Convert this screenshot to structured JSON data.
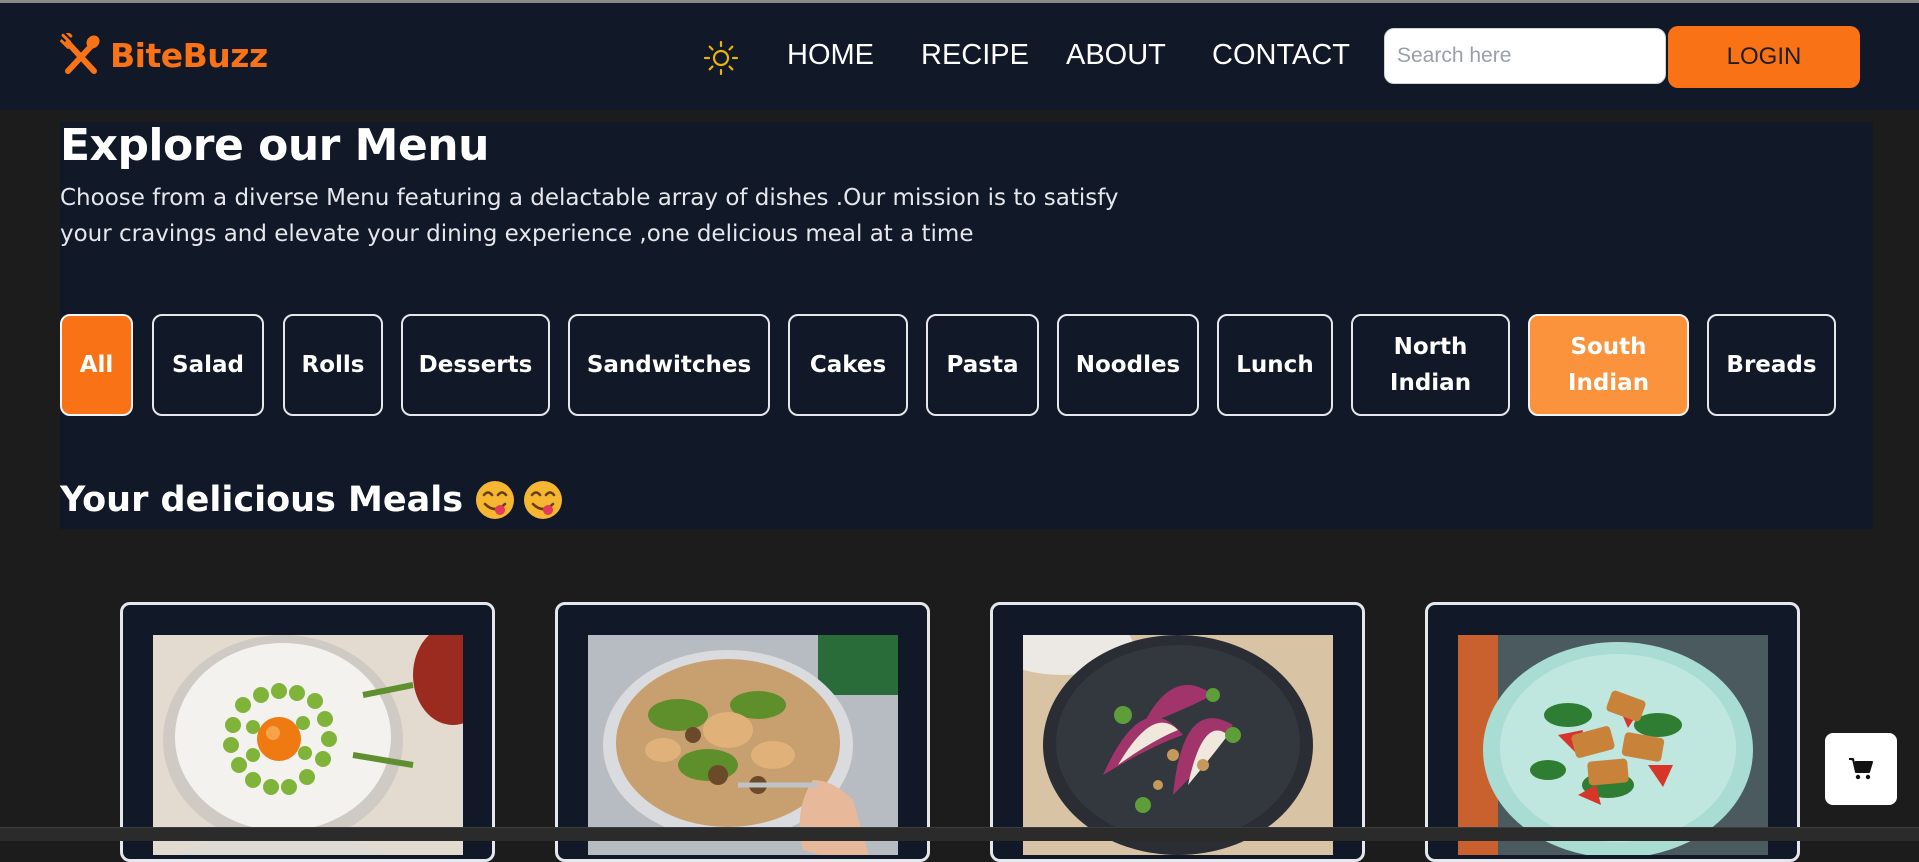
{
  "brand": {
    "name": "BiteBuzz",
    "accent": "#f97316",
    "logo_icon": "fork-knife-icon"
  },
  "nav": {
    "theme_icon": "sun-icon",
    "links": [
      "HOME",
      "RECIPE",
      "ABOUT",
      "CONTACT"
    ],
    "search_placeholder": "Search here",
    "login_label": "LOGIN"
  },
  "menu": {
    "title": "Explore our Menu",
    "description": " Choose from a diverse Menu featuring a delactable array of dishes .Our mission is to satisfy your cravings and elevate your dining experience ,one delicious meal at a time",
    "categories": [
      {
        "label": "All",
        "state": "active"
      },
      {
        "label": "Salad"
      },
      {
        "label": "Rolls"
      },
      {
        "label": "Desserts"
      },
      {
        "label": "Sandwitches"
      },
      {
        "label": "Cakes"
      },
      {
        "label": "Pasta"
      },
      {
        "label": "Noodles"
      },
      {
        "label": "Lunch"
      },
      {
        "label": "North Indian"
      },
      {
        "label": "South Indian",
        "state": "highlighted"
      },
      {
        "label": "Breads"
      }
    ]
  },
  "meals": {
    "heading": "Your delicious Meals",
    "emoji_icons": [
      "yum-face-icon",
      "yum-face-icon"
    ],
    "cards": [
      {
        "image": "asparagus-egg-plate-image"
      },
      {
        "image": "salad-bowl-fork-image"
      },
      {
        "image": "endive-walnut-salad-image"
      },
      {
        "image": "grilled-halloumi-salad-image"
      }
    ]
  },
  "cart": {
    "icon": "cart-icon"
  },
  "colors": {
    "panel": "#111827",
    "background": "#1c1c1c",
    "highlight": "#fb923c"
  }
}
